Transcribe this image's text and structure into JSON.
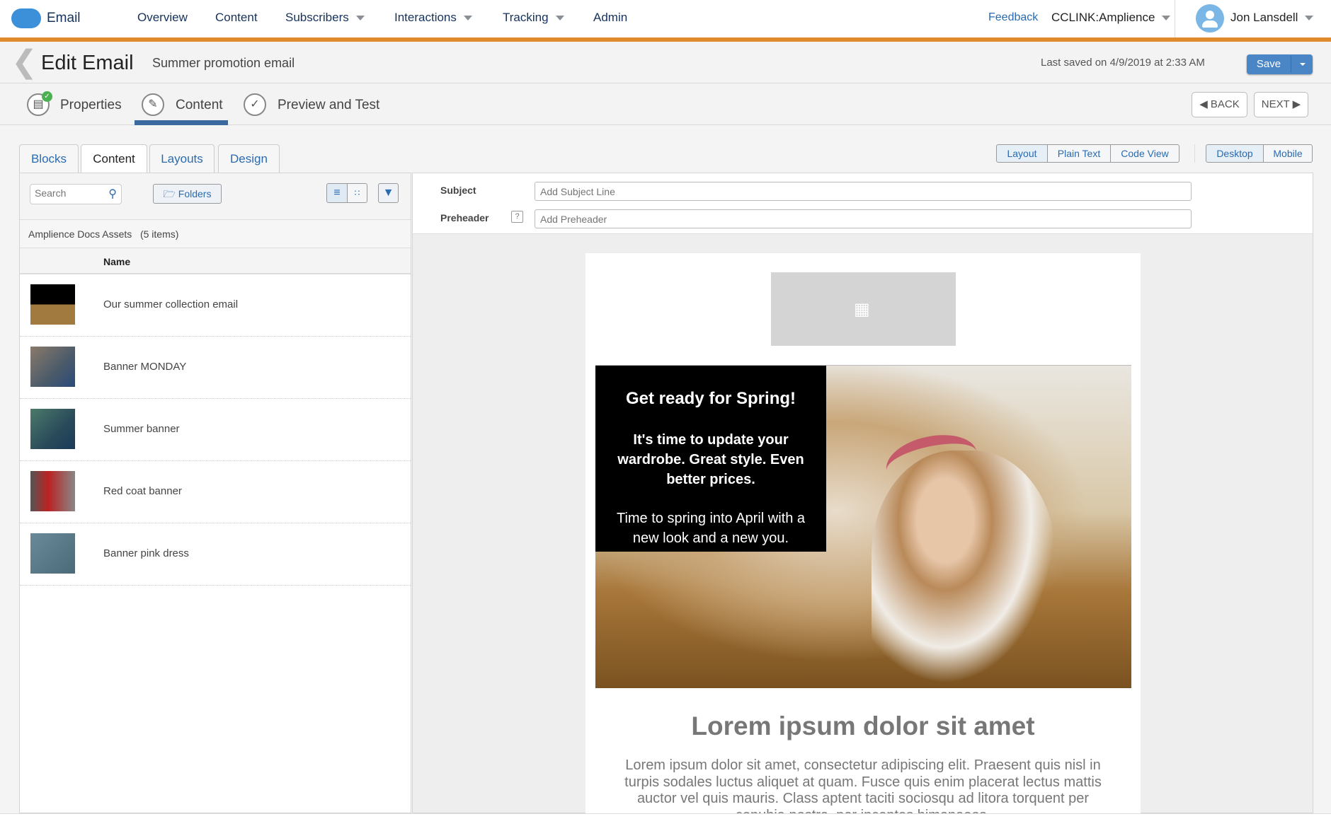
{
  "topnav": {
    "app": "Email",
    "items": [
      {
        "label": "Overview"
      },
      {
        "label": "Content"
      },
      {
        "label": "Subscribers",
        "dropdown": true
      },
      {
        "label": "Interactions",
        "dropdown": true
      },
      {
        "label": "Tracking",
        "dropdown": true
      },
      {
        "label": "Admin"
      }
    ],
    "feedback": "Feedback",
    "account": "CCLINK:Amplience",
    "user": "Jon Lansdell"
  },
  "header": {
    "title": "Edit Email",
    "subtitle": "Summer promotion email",
    "last_saved": "Last saved on 4/9/2019 at 2:33 AM",
    "save": "Save"
  },
  "steps": {
    "items": [
      {
        "label": "Properties",
        "done": true
      },
      {
        "label": "Content",
        "active": true
      },
      {
        "label": "Preview and Test"
      }
    ],
    "back": "BACK",
    "next": "NEXT"
  },
  "tabs": [
    {
      "label": "Blocks"
    },
    {
      "label": "Content",
      "active": true
    },
    {
      "label": "Layouts"
    },
    {
      "label": "Design"
    }
  ],
  "view_modes": [
    "Layout",
    "Plain Text",
    "Code View"
  ],
  "device_modes": [
    "Desktop",
    "Mobile"
  ],
  "library": {
    "search_placeholder": "Search",
    "folders": "Folders",
    "folder_name": "Amplience Docs Assets",
    "count": "(5 items)",
    "column": "Name",
    "items": [
      {
        "name": "Our summer collection email"
      },
      {
        "name": "Banner MONDAY"
      },
      {
        "name": "Summer banner"
      },
      {
        "name": "Red coat banner"
      },
      {
        "name": "Banner pink dress"
      }
    ]
  },
  "fields": {
    "subject_label": "Subject",
    "subject_placeholder": "Add Subject Line",
    "preheader_label": "Preheader",
    "preheader_help": "?",
    "preheader_placeholder": "Add Preheader"
  },
  "email": {
    "hero_title": "Get ready for Spring!",
    "hero_body": "It's time to update your wardrobe. Great style. Even better prices.",
    "hero_footer": "Time to spring into April with a new look and a new you.",
    "heading": "Lorem ipsum dolor sit amet",
    "paragraph": "Lorem ipsum dolor sit amet, consectetur adipiscing elit. Praesent quis nisl in turpis sodales luctus aliquet at quam. Fusce quis enim placerat lectus mattis auctor vel quis mauris. Class aptent taciti sociosqu ad litora torquent per conubia nostra, per inceptos himenaeos."
  },
  "colors": {
    "accent": "#e08a2e",
    "brand": "#3c8fd9",
    "save": "#4a86c5"
  }
}
